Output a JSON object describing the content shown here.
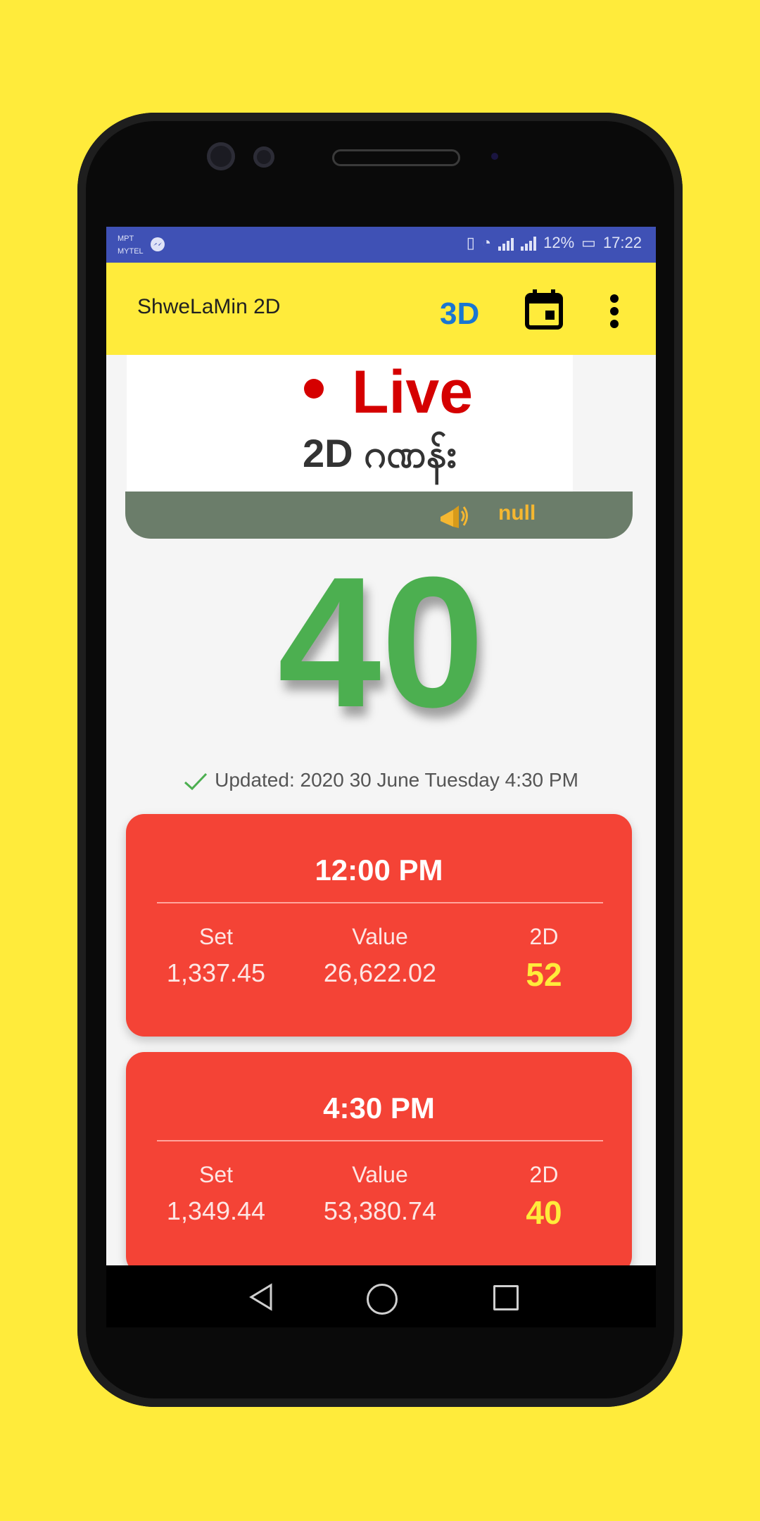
{
  "statusbar": {
    "carrier1": "MPT",
    "carrier2": "MYTEL",
    "battery": "12%",
    "time": "17:22"
  },
  "appbar": {
    "title": "ShweLaMin 2D",
    "btn_3d": "3D",
    "calendar_icon": "calendar-icon",
    "more_icon": "more-vert-icon"
  },
  "banner": {
    "live": "Live",
    "subtitle": "2D ဂဏန်း"
  },
  "marquee": {
    "text": "null",
    "icon": "megaphone-icon"
  },
  "live_number": "40",
  "updated": "Updated: 2020 30 June Tuesday 4:30 PM",
  "results": [
    {
      "time": "12:00 PM",
      "set_label": "Set",
      "value_label": "Value",
      "twod_label": "2D",
      "set": "1,337.45",
      "value": "26,622.02",
      "twod": "52"
    },
    {
      "time": "4:30 PM",
      "set_label": "Set",
      "value_label": "Value",
      "twod_label": "2D",
      "set": "1,349.44",
      "value": "53,380.74",
      "twod": "40"
    }
  ],
  "colors": {
    "background": "#ffeb3b",
    "statusbar": "#3f51b5",
    "card": "#f44336",
    "number": "#4caf50",
    "accent_3d": "#1976d2"
  }
}
